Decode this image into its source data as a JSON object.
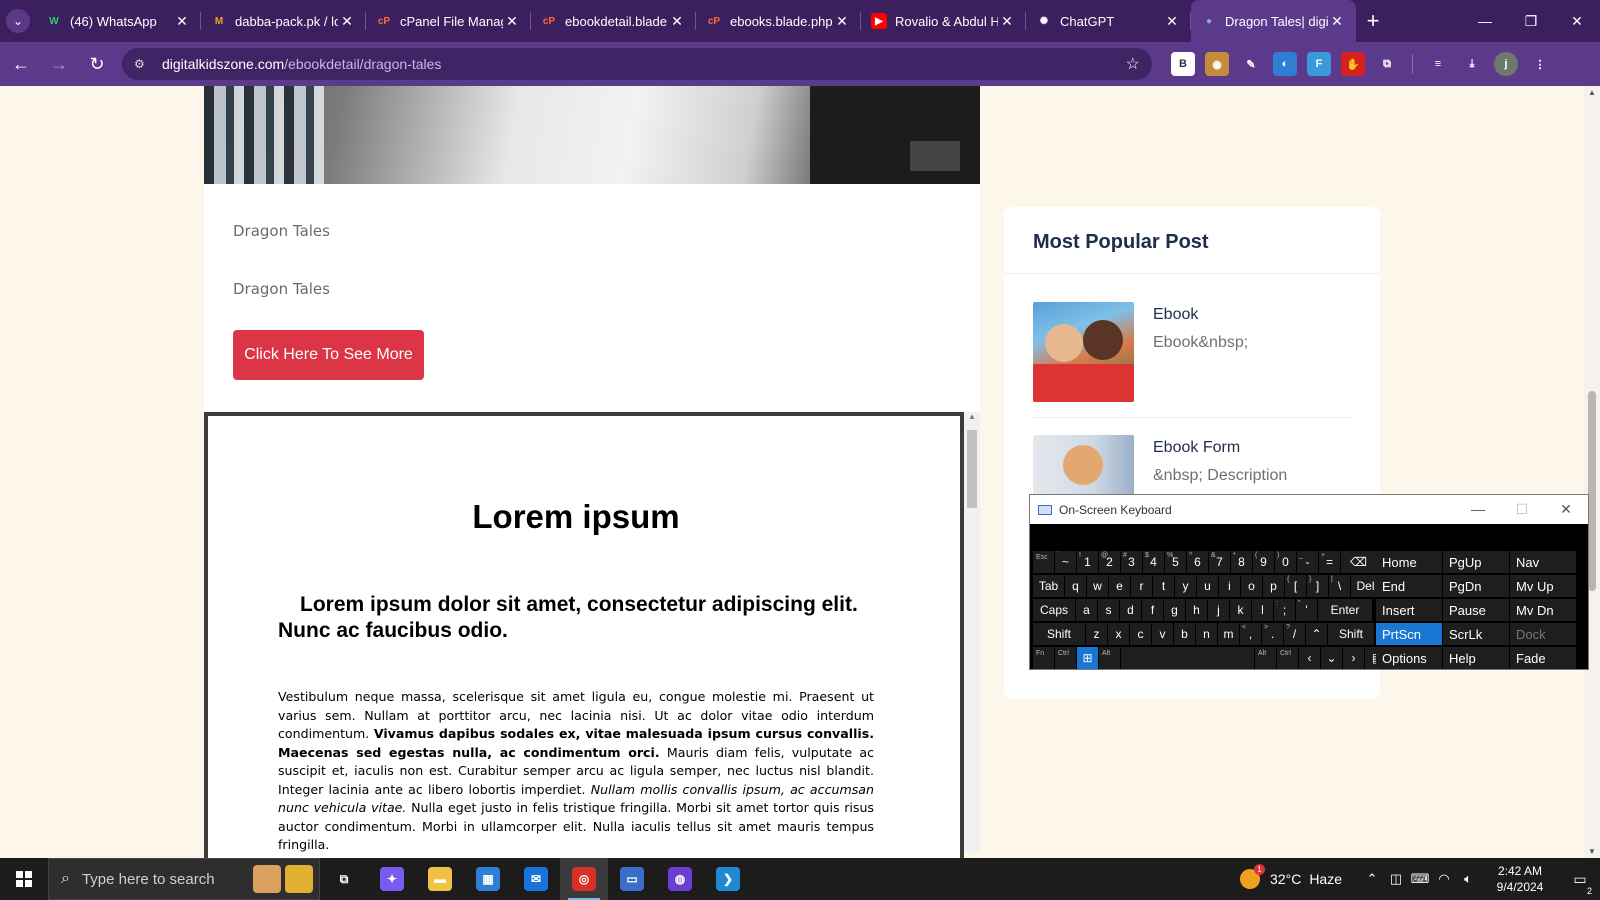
{
  "browser": {
    "tabs": [
      {
        "title": "(46) WhatsApp",
        "icon": "whatsapp-icon",
        "color": "#25d366",
        "glyph": "W",
        "active": false
      },
      {
        "title": "dabba-pack.pk / lo",
        "icon": "phpmyadmin-icon",
        "color": "#f0a020",
        "glyph": "M",
        "active": false
      },
      {
        "title": "cPanel File Manag",
        "icon": "cpanel-icon",
        "color": "#ff6c2c",
        "glyph": "cP",
        "active": false
      },
      {
        "title": "ebookdetail.blade.",
        "icon": "cpanel-icon",
        "color": "#ff6c2c",
        "glyph": "cP",
        "active": false
      },
      {
        "title": "ebooks.blade.php",
        "icon": "cpanel-icon",
        "color": "#ff6c2c",
        "glyph": "cP",
        "active": false
      },
      {
        "title": "Rovalio & Abdul H",
        "icon": "youtube-icon",
        "color": "#ff0000",
        "glyph": "▶",
        "active": false
      },
      {
        "title": "ChatGPT",
        "icon": "chatgpt-icon",
        "color": "#ffffff",
        "glyph": "✺",
        "active": false
      },
      {
        "title": "Dragon Tales| digi",
        "icon": "site-favicon-icon",
        "color": "#8aa4e8",
        "glyph": "●",
        "active": true
      }
    ],
    "url_host": "digitalkidszone.com",
    "url_path": "/ebookdetail/dragon-tales",
    "extensions": [
      {
        "name": "extension-b-icon",
        "glyph": "B",
        "color": "#ffffff",
        "fg": "#333"
      },
      {
        "name": "cookie-extension-icon",
        "glyph": "◉",
        "color": "#c58a3a",
        "fg": "#fff"
      },
      {
        "name": "eyedropper-extension-icon",
        "glyph": "✎",
        "color": "transparent",
        "fg": "#fff"
      },
      {
        "name": "edge-extension-icon",
        "glyph": "◐",
        "color": "#2d7fd6",
        "fg": "#fff"
      },
      {
        "name": "font-extension-icon",
        "glyph": "F",
        "color": "#3a9ad9",
        "fg": "#fff"
      },
      {
        "name": "hand-extension-icon",
        "glyph": "✋",
        "color": "#d82020",
        "fg": "#fff"
      },
      {
        "name": "puzzle-extensions-icon",
        "glyph": "⧉",
        "color": "transparent",
        "fg": "#fff"
      }
    ],
    "profile_initial": "j"
  },
  "page": {
    "ebook_title": "Dragon Tales",
    "ebook_desc": "Dragon Tales",
    "cta_label": "Click Here To See More",
    "doc": {
      "h1": "Lorem ipsum",
      "h2": "Lorem ipsum dolor sit amet, consectetur adipiscing elit. Nunc ac faucibus odio.",
      "p_1": "Vestibulum neque massa, scelerisque sit amet ligula eu, congue molestie mi. Praesent ut varius sem. Nullam at porttitor arcu, nec lacinia nisi. Ut ac dolor vitae odio interdum condimentum. ",
      "p_bold": "Vivamus dapibus sodales ex, vitae malesuada ipsum cursus convallis. Maecenas sed egestas nulla, ac condimentum orci.",
      "p_2": " Mauris diam felis, vulputate ac suscipit et, iaculis non est. Curabitur semper arcu ac ligula semper, nec luctus nisl blandit. Integer lacinia ante ac libero lobortis imperdiet. ",
      "p_italic": "Nullam mollis convallis ipsum, ac accumsan nunc vehicula vitae.",
      "p_3": " Nulla eget justo in felis tristique fringilla. Morbi sit amet tortor quis risus auctor condimentum. Morbi in ullamcorper elit. Nulla iaculis tellus sit amet mauris tempus fringilla."
    },
    "sidebar": {
      "title": "Most Popular Post",
      "posts": [
        {
          "title": "Ebook",
          "desc": "Ebook&nbsp;"
        },
        {
          "title": "Ebook Form",
          "desc": "&nbsp; Description"
        }
      ]
    }
  },
  "osk": {
    "title": "On-Screen Keyboard",
    "rows": [
      [
        {
          "l": "Esc",
          "s": "sm",
          "w": 20
        },
        {
          "l": "~",
          "sub": "`",
          "w": 20
        },
        {
          "l": "1",
          "sub": "!",
          "w": 20
        },
        {
          "l": "2",
          "sub": "@",
          "w": 20
        },
        {
          "l": "3",
          "sub": "#",
          "w": 20
        },
        {
          "l": "4",
          "sub": "$",
          "w": 20
        },
        {
          "l": "5",
          "sub": "%",
          "w": 20
        },
        {
          "l": "6",
          "sub": "^",
          "w": 20
        },
        {
          "l": "7",
          "sub": "&",
          "w": 20
        },
        {
          "l": "8",
          "sub": "*",
          "w": 20
        },
        {
          "l": "9",
          "sub": "(",
          "w": 20
        },
        {
          "l": "0",
          "sub": ")",
          "w": 20
        },
        {
          "l": "-",
          "sub": "_",
          "w": 20
        },
        {
          "l": "=",
          "sub": "+",
          "w": 20
        },
        {
          "l": "⌫",
          "w": 34
        }
      ],
      [
        {
          "l": "Tab",
          "w": 30
        },
        {
          "l": "q",
          "w": 20
        },
        {
          "l": "w",
          "w": 20
        },
        {
          "l": "e",
          "w": 20
        },
        {
          "l": "r",
          "w": 20
        },
        {
          "l": "t",
          "w": 20
        },
        {
          "l": "y",
          "w": 20
        },
        {
          "l": "u",
          "w": 20
        },
        {
          "l": "i",
          "w": 20
        },
        {
          "l": "o",
          "w": 20
        },
        {
          "l": "p",
          "w": 20
        },
        {
          "l": "[",
          "sub": "{",
          "w": 20
        },
        {
          "l": "]",
          "sub": "}",
          "w": 20
        },
        {
          "l": "\\",
          "sub": "|",
          "w": 20
        },
        {
          "l": "Del",
          "w": 28
        }
      ],
      [
        {
          "l": "Caps",
          "w": 40
        },
        {
          "l": "a",
          "w": 20
        },
        {
          "l": "s",
          "w": 20
        },
        {
          "l": "d",
          "w": 20
        },
        {
          "l": "f",
          "w": 20
        },
        {
          "l": "g",
          "w": 20
        },
        {
          "l": "h",
          "w": 20
        },
        {
          "l": "j",
          "w": 20
        },
        {
          "l": "k",
          "w": 20
        },
        {
          "l": "l",
          "w": 20
        },
        {
          "l": ";",
          "sub": ":",
          "w": 20
        },
        {
          "l": "'",
          "sub": "\"",
          "w": 20
        },
        {
          "l": "Enter",
          "w": 52
        }
      ],
      [
        {
          "l": "Shift",
          "w": 50
        },
        {
          "l": "z",
          "w": 20
        },
        {
          "l": "x",
          "w": 20
        },
        {
          "l": "c",
          "w": 20
        },
        {
          "l": "v",
          "w": 20
        },
        {
          "l": "b",
          "w": 20
        },
        {
          "l": "n",
          "w": 20
        },
        {
          "l": "m",
          "w": 20
        },
        {
          "l": ",",
          "sub": "<",
          "w": 20
        },
        {
          "l": ".",
          "sub": ">",
          "w": 20
        },
        {
          "l": "/",
          "sub": "?",
          "w": 20
        },
        {
          "l": "⌃",
          "w": 20
        },
        {
          "l": "Shift",
          "w": 44
        }
      ],
      [
        {
          "l": "Fn",
          "s": "sm",
          "w": 20
        },
        {
          "l": "Ctrl",
          "s": "sm",
          "w": 20
        },
        {
          "l": "⊞",
          "s": "win",
          "w": 20
        },
        {
          "l": "Alt",
          "s": "sm",
          "w": 20
        },
        {
          "l": "",
          "w": 128
        },
        {
          "l": "Alt",
          "s": "sm",
          "w": 20
        },
        {
          "l": "Ctrl",
          "s": "sm",
          "w": 20
        },
        {
          "l": "‹",
          "w": 20
        },
        {
          "l": "⌄",
          "w": 20
        },
        {
          "l": "›",
          "w": 20
        },
        {
          "l": "▤",
          "w": 24
        }
      ]
    ],
    "nav_keys": [
      [
        "Home",
        "PgUp",
        "Nav"
      ],
      [
        "End",
        "PgDn",
        "Mv Up"
      ],
      [
        "Insert",
        "Pause",
        "Mv Dn"
      ],
      [
        "PrtScn",
        "ScrLk",
        "Dock"
      ],
      [
        "Options",
        "Help",
        "Fade"
      ]
    ]
  },
  "taskbar": {
    "search_placeholder": "Type here to search",
    "apps": [
      {
        "name": "task-view-icon",
        "glyph": "⧉",
        "color": "transparent"
      },
      {
        "name": "copilot-icon",
        "glyph": "✦",
        "color": "#7a5af0"
      },
      {
        "name": "file-explorer-icon",
        "glyph": "▬",
        "color": "#f2c144"
      },
      {
        "name": "microsoft-store-icon",
        "glyph": "▦",
        "color": "#2d7fd6"
      },
      {
        "name": "mail-icon",
        "glyph": "✉",
        "color": "#1a73d9"
      },
      {
        "name": "chrome-icon",
        "glyph": "◎",
        "color": "#d93025",
        "active": true
      },
      {
        "name": "remote-desktop-icon",
        "glyph": "▭",
        "color": "#3a6fc8"
      },
      {
        "name": "github-desktop-icon",
        "glyph": "◍",
        "color": "#6a3fd0"
      },
      {
        "name": "vscode-icon",
        "glyph": "❯",
        "color": "#1f8ad2"
      }
    ],
    "weather_temp": "32°C",
    "weather_desc": "Haze",
    "weather_badge": "1",
    "time": "2:42 AM",
    "date": "9/4/2024",
    "notif_count": "2"
  }
}
